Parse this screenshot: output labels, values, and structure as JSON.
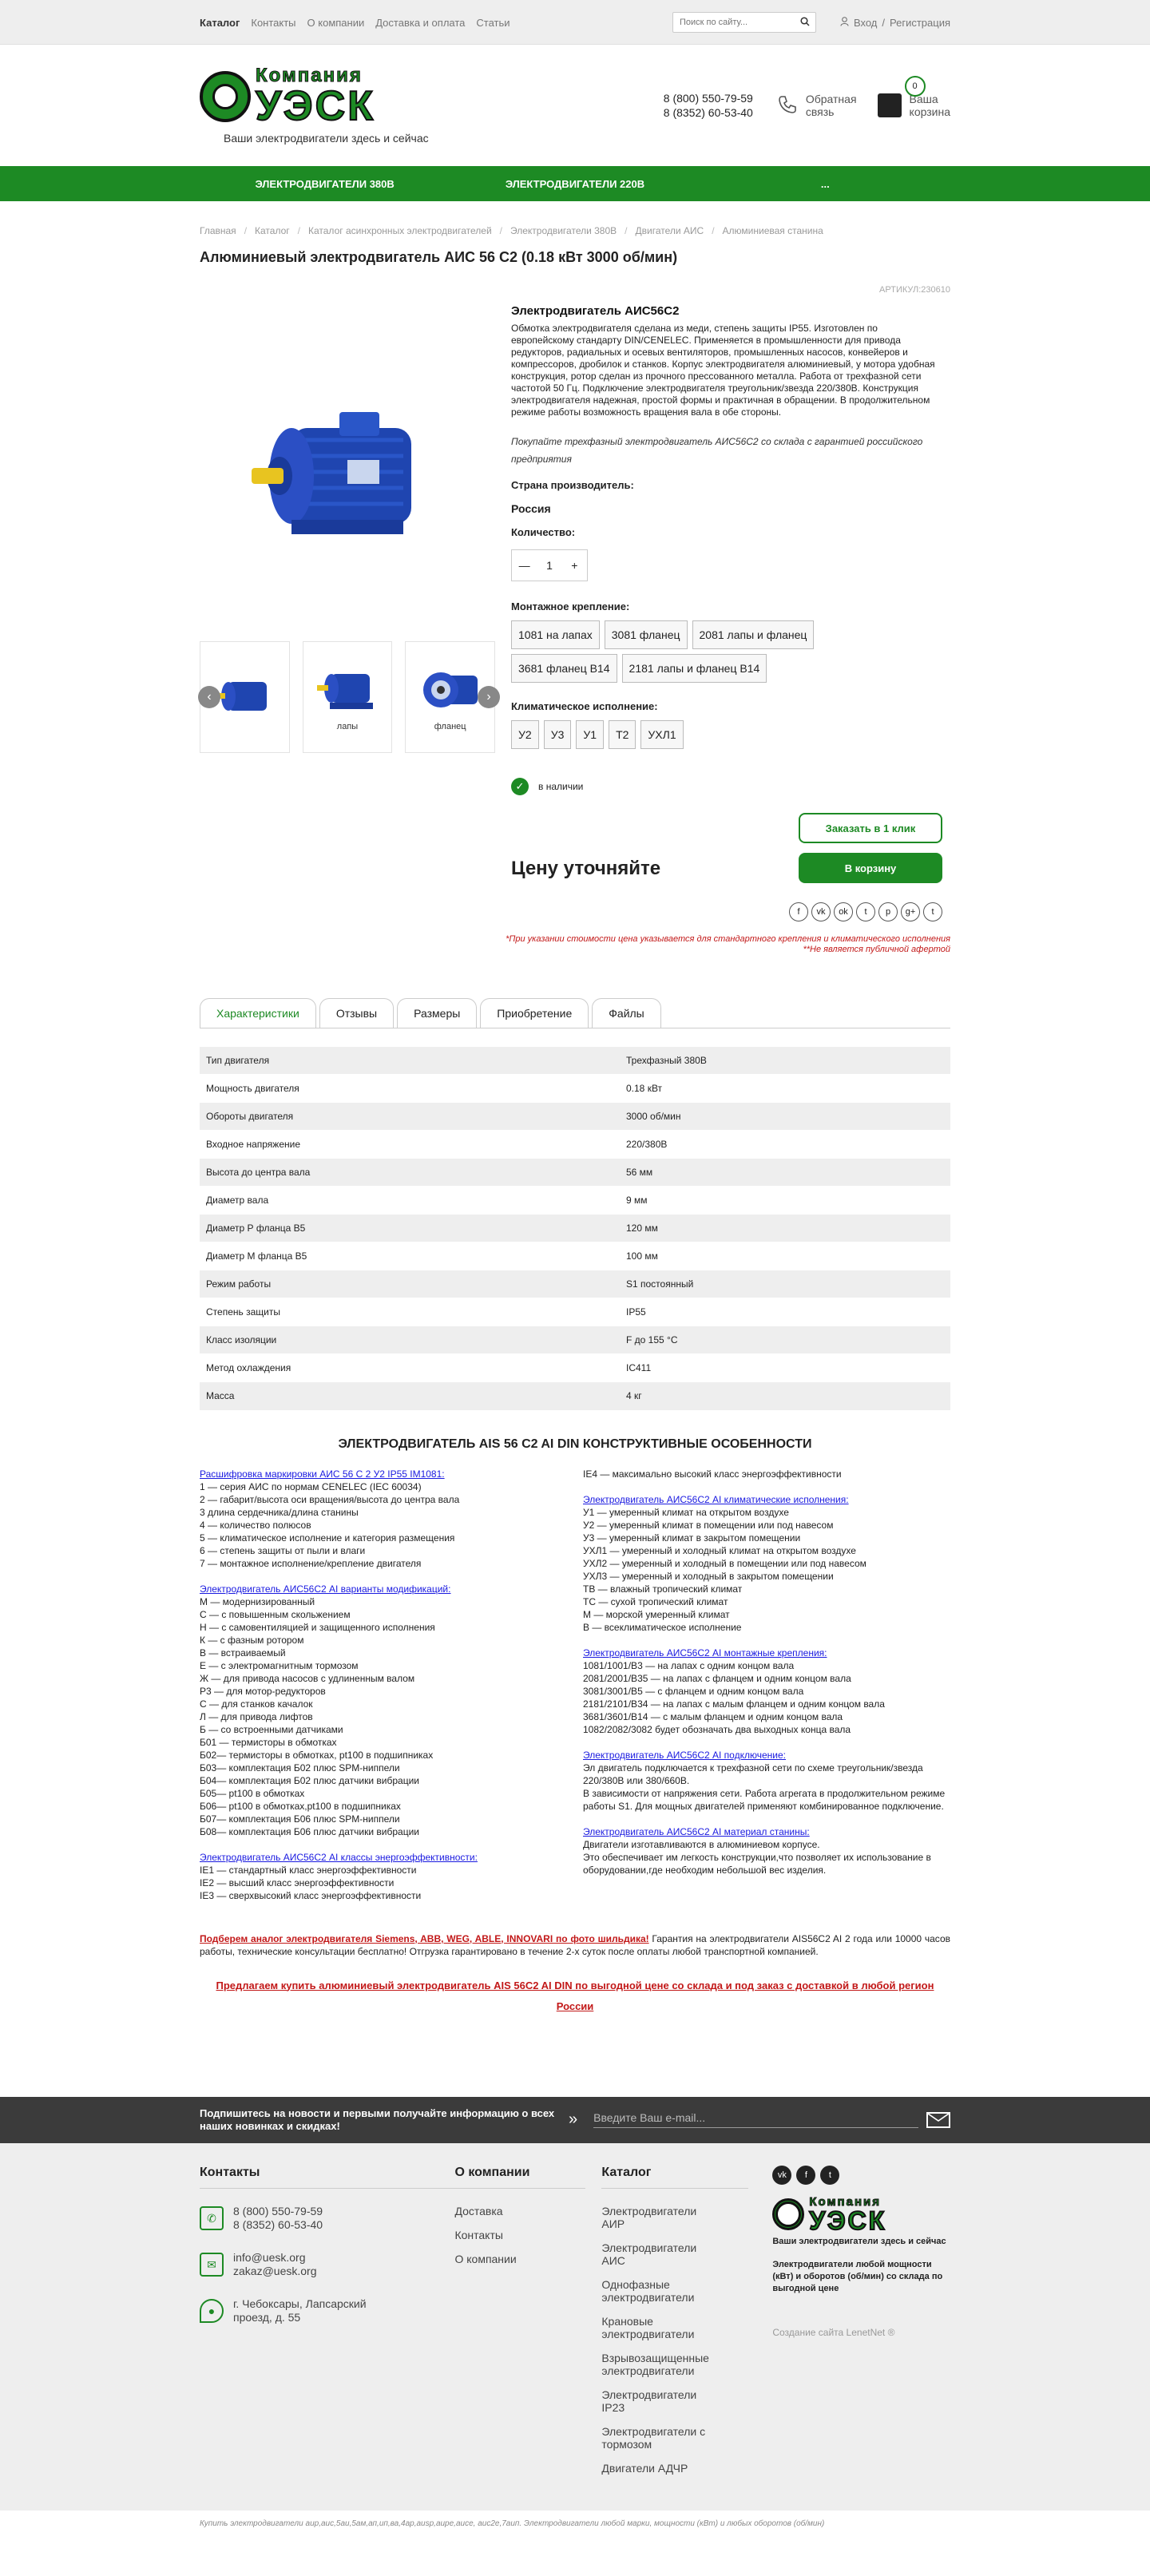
{
  "topnav": {
    "items": [
      "Каталог",
      "Контакты",
      "О компании",
      "Доставка и оплата",
      "Статьи"
    ],
    "search_placeholder": "Поиск по сайту...",
    "login": "Вход",
    "register": "Регистрация",
    "login_separator": "/"
  },
  "header": {
    "logo_top": "Компания",
    "logo_main": "УЭСК",
    "slogan": "Ваши электродвигатели здесь и сейчас",
    "phone1": "8 (800) 550-79-59",
    "phone2": "8 (8352) 60-53-40",
    "callback_1": "Обратная",
    "callback_2": "связь",
    "cart_count": "0",
    "cart_1": "Ваша",
    "cart_2": "корзина"
  },
  "greennav": [
    "ЭЛЕКТРОДВИГАТЕЛИ 380В",
    "ЭЛЕКТРОДВИГАТЕЛИ 220В",
    "..."
  ],
  "breadcrumbs": [
    "Главная",
    "Каталог",
    "Каталог асинхронных электродвигателей",
    "Электродвигатели 380В",
    "Двигатели АИС",
    "Алюминиевая станина"
  ],
  "product": {
    "title": "Алюминиевый электродвигатель АИС 56 С2 (0.18 кВт 3000 об/мин)",
    "sku": "АРТИКУЛ:230610",
    "name": "Электродвигатель АИС56С2",
    "description": "Обмотка электродвигателя сделана из меди, степень защиты IP55. Изготовлен по европейскому стандарту DIN/CENELEC. Применяется в промышленности для привода редукторов, радиальных и осевых вентиляторов, промышленных насосов, конвейеров и компрессоров, дробилок и станков. Корпус электродвигателя алюминиевый, у мотора удобная конструкция, ротор сделан из прочного прессованного металла. Работа от трехфазной сети частотой 50 Гц. Подключение электродвигателя треугольник/звезда 220/380В. Конструкция электродвигателя надежная, простой формы и практичная в обращении. В продолжительном режиме работы возможность вращения вала в обе стороны.",
    "note": "Покупайте трехфазный электродвигатель АИС56С2 со склада с гарантией российского предприятия",
    "country_label": "Страна производитель:",
    "country": "Россия",
    "qty_label": "Количество:",
    "qty": "1",
    "mount_label": "Монтажное крепление:",
    "mounts": [
      "1081 на лапах",
      "3081 фланец",
      "2081 лапы и фланец",
      "3681 фланец В14",
      "2181 лапы и фланец В14"
    ],
    "climate_label": "Климатическое исполнение:",
    "climates": [
      "У2",
      "У3",
      "У1",
      "Т2",
      "УХЛ1"
    ],
    "stock": "в наличии",
    "price": "Цену уточняйте",
    "btn_oneclick": "Заказать в 1 клик",
    "btn_cart": "В корзину",
    "thumbs": [
      "",
      "лапы",
      "фланец"
    ],
    "disclaimer1": "*При указании стоимости цена указывается для стандартного крепления и климатического исполнения",
    "disclaimer2": "**Не является публичной афертой"
  },
  "tabs": [
    "Характеристики",
    "Отзывы",
    "Размеры",
    "Приобретение",
    "Файлы"
  ],
  "specs": [
    [
      "Тип двигателя",
      "Трехфазный 380В"
    ],
    [
      "Мощность двигателя",
      "0.18 кВт"
    ],
    [
      "Обороты двигателя",
      "3000 об/мин"
    ],
    [
      "Входное напряжение",
      "220/380В"
    ],
    [
      "Высота до центра вала",
      "56 мм"
    ],
    [
      "Диаметр вала",
      "9 мм"
    ],
    [
      "Диаметр Р фланца В5",
      "120 мм"
    ],
    [
      "Диаметр М фланца В5",
      "100 мм"
    ],
    [
      "Режим работы",
      "S1 постоянный"
    ],
    [
      "Степень защиты",
      "IP55"
    ],
    [
      "Класс изоляции",
      "F до 155 °С"
    ],
    [
      "Метод охлаждения",
      "IC411"
    ],
    [
      "Масса",
      "4 кг"
    ]
  ],
  "section_title": "ЭЛЕКТРОДВИГАТЕЛЬ AIS 56 C2 AI DIN КОНСТРУКТИВНЫЕ ОСОБЕННОСТИ",
  "left_blocks": [
    {
      "title": "Расшифровка маркировки АИС 56 С 2 У2 IP55 IM1081:",
      "lines": [
        "1 — серия АИС по нормам CENELEC (IEC 60034)",
        "2 — габарит/высота оси вращения/высота до центра вала",
        "3 длина сердечника/длина станины",
        "4 — количество полюсов",
        "5 — климатическое исполнение и категория размещения",
        "6 — степень защиты от пыли и влаги",
        "7 — монтажное исполнение/крепление двигателя"
      ]
    },
    {
      "title": "Электродвигатель АИС56С2 AI варианты модификаций:",
      "lines": [
        "М — модернизированный",
        "С — с повышенным скольжением",
        "Н — с самовентиляцией и защищенного исполнения",
        "К — с фазным ротором",
        "В — встраиваемый",
        "Е — с электромагнитным тормозом",
        "Ж — для привода насосов с удлиненным валом",
        "Р3 — для мотор-редукторов",
        "С — для станков качалок",
        "Л — для привода лифтов",
        "Б — со встроенными датчиками",
        "Б01 — термисторы в обмотках",
        "Б02— термисторы в обмотках, pt100 в подшипниках",
        "Б03— комплектация Б02 плюс SPM-ниппели",
        "Б04— комплектация Б02 плюс датчики вибрации",
        "Б05— pt100 в обмотках",
        "Б06— pt100 в обмотках,pt100 в подшипниках",
        "Б07— комплектация Б06 плюс SPM-ниппели",
        "Б08— комплектация Б06 плюс датчики вибрации"
      ]
    },
    {
      "title": "Электродвигатель АИС56С2 AI классы энергоэффективности:",
      "lines": [
        "IE1 — стандартный класс энергоэффективности",
        "IE2 — высший класс энергоэффективности",
        "IE3 — сверхвысокий класс энергоэффективности"
      ]
    }
  ],
  "right_blocks": [
    {
      "title": "",
      "lines": [
        "IE4 — максимально высокий класс энергоэффективности"
      ]
    },
    {
      "title": "Электродвигатель АИС56С2 AI климатические исполнения:",
      "lines": [
        "У1 — умеренный климат на открытом воздухе",
        "У2 — умеренный климат в помещении или под навесом",
        "У3 — умеренный климат в закрытом помещении",
        "УХЛ1 — умеренный и холодный климат на открытом воздухе",
        "УХЛ2 — умеренный и холодный в помещении или под навесом",
        "УХЛ3 — умеренный и холодный в закрытом помещении",
        "ТВ — влажный тропический климат",
        "ТС — сухой тропический климат",
        "М — морской умеренный климат",
        "В — всеклиматическое исполнение"
      ]
    },
    {
      "title": "Электродвигатель АИС56С2 AI монтажные крепления:",
      "lines": [
        "1081/1001/В3 — на лапах с одним концом вала",
        "2081/2001/В35 — на лапах с фланцем и одним концом вала",
        "3081/3001/В5 — с фланцем и одним концом вала",
        "2181/2101/В34 — на лапах с малым фланцем и одним концом вала",
        "3681/3601/В14 — с малым фланцем и одним концом вала",
        "1082/2082/3082 будет обозначать два выходных конца вала"
      ]
    },
    {
      "title": "Электродвигатель АИС56С2 AI подключение:",
      "lines": [
        "Эл двигатель подключается к трехфазной сети по схеме треугольник/звезда 220/380В или 380/660В.",
        "В зависимости от напряжения сети. Работа агрегата в продолжительном режиме работы S1. Для мощных двигателей применяют комбинированное подключение."
      ]
    },
    {
      "title": "Электродвигатель АИС56С2 AI материал станины:",
      "lines": [
        "Двигатели изготавливаются в алюминиевом корпусе.",
        "Это обеспечивает им легкость конструкции,что позволяет их использование в оборудовании,где необходим небольшой вес изделия."
      ]
    }
  ],
  "promo": {
    "red_part": "Подберем аналог электродвигателя Siemens, ABB, WEG, ABLE, INNOVARI по фото шильдика!",
    "rest": " Гарантия на электродвигатели AIS56C2 AI 2 года или 10000 часов работы, технические консультации бесплатно! Отгрузка гарантировано в течение 2-х суток после оплаты любой транспортной компанией.",
    "offer": "Предлагаем купить алюминиевый электродвигатель AIS 56C2 AI DIN по выгодной цене со склада и под заказ с доставкой в любой регион России"
  },
  "subscribe": {
    "text": "Подпишитесь на новости и первыми получайте информацию о всех наших новинках и скидках!",
    "placeholder": "Введите Ваш e-mail..."
  },
  "footer": {
    "contacts_title": "Контакты",
    "phone1": "8 (800) 550-79-59",
    "phone2": "8 (8352) 60-53-40",
    "email1": "info@uesk.org",
    "email2": "zakaz@uesk.org",
    "address": "г. Чебоксары, Лапсарский проезд, д. 55",
    "about_title": "О компании",
    "about_links": [
      "Доставка",
      "Контакты",
      "О компании"
    ],
    "catalog_title": "Каталог",
    "catalog_links": [
      "Электродвигатели АИР",
      "Электродвигатели АИС",
      "Однофазные электродвигатели",
      "Крановые электродвигатели",
      "Взрывозащищенные электродвигатели",
      "Электродвигатели IP23",
      "Электродвигатели с тормозом",
      "Двигатели АДЧР"
    ],
    "slogan": "Ваши электродвигатели здесь и сейчас",
    "desc": "Электродвигатели любой мощности (кВт) и оборотов (об/мин) со склада по выгодной цене",
    "creator": "Создание сайта LenetNet ®",
    "bottom": "Купить электродвигатели аир,аис,5аи,5ам,ап,ип,ва,4ар,аиsp,аире,аисе, аис2е,7аип. Электродвигатели любой марки, мощности (кВт) и любых оборотов (об/мин)"
  },
  "colors": {
    "brand_green": "#1d8a24",
    "accent_red": "#c21818",
    "link_blue": "#1a1ae0"
  }
}
